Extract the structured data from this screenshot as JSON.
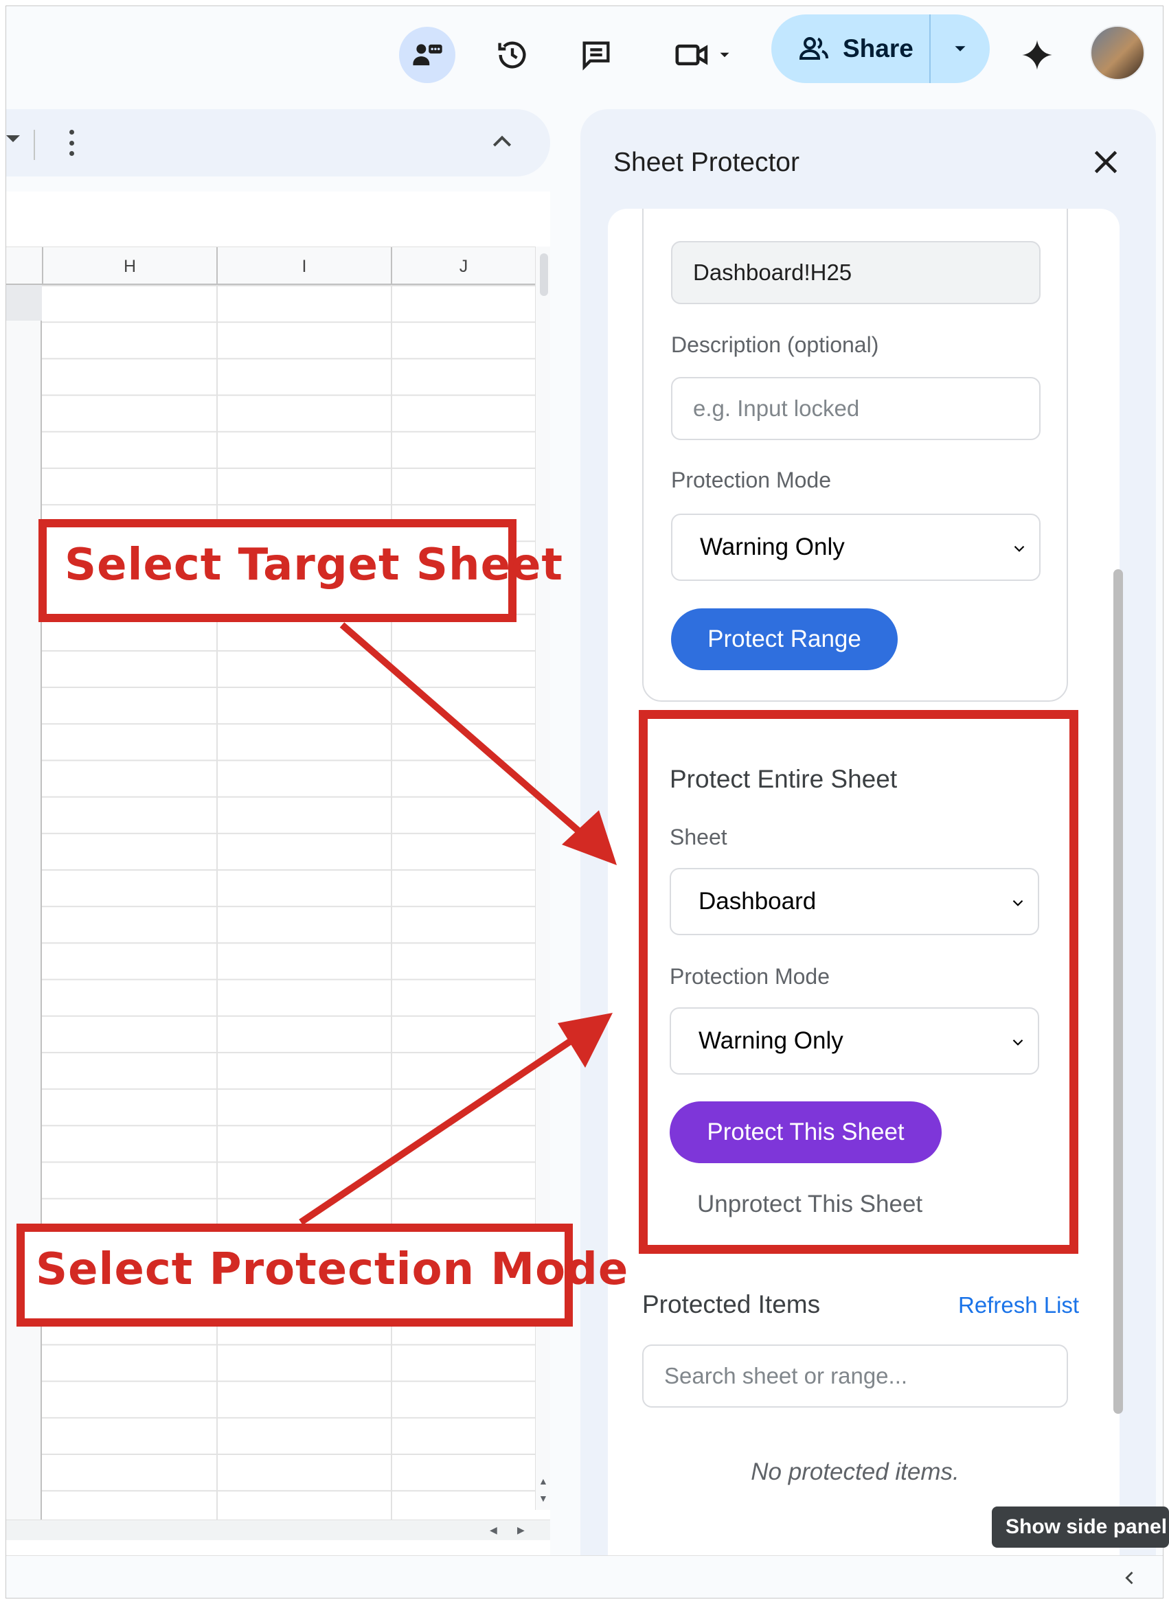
{
  "toolbar": {
    "share_label": "Share",
    "icons": [
      "meet-people-icon",
      "history-icon",
      "comment-icon",
      "video-icon",
      "gemini-sparkle-icon"
    ]
  },
  "grid": {
    "columns": [
      "H",
      "I",
      "J"
    ]
  },
  "panel": {
    "title": "Sheet Protector",
    "range_value": "Dashboard!H25",
    "description_label": "Description (optional)",
    "description_placeholder": "e.g. Input locked",
    "range_mode_label": "Protection Mode",
    "range_mode_value": "Warning Only",
    "protect_range_button": "Protect Range",
    "entire_sheet": {
      "title": "Protect Entire Sheet",
      "sheet_label": "Sheet",
      "sheet_value": "Dashboard",
      "mode_label": "Protection Mode",
      "mode_value": "Warning Only",
      "protect_button": "Protect This Sheet",
      "unprotect_button": "Unprotect This Sheet"
    },
    "protected_items": {
      "title": "Protected Items",
      "refresh_label": "Refresh List",
      "search_placeholder": "Search sheet or range...",
      "empty_text": "No protected items."
    }
  },
  "tooltip": "Show side panel",
  "annotations": {
    "target_sheet": "Select Target Sheet",
    "protection_mode": "Select Protection Mode"
  },
  "colors": {
    "annotation_red": "#d32a23",
    "protect_range_blue": "#2f6fde",
    "protect_sheet_purple": "#7e36d9",
    "share_bg": "#c2e7ff"
  }
}
